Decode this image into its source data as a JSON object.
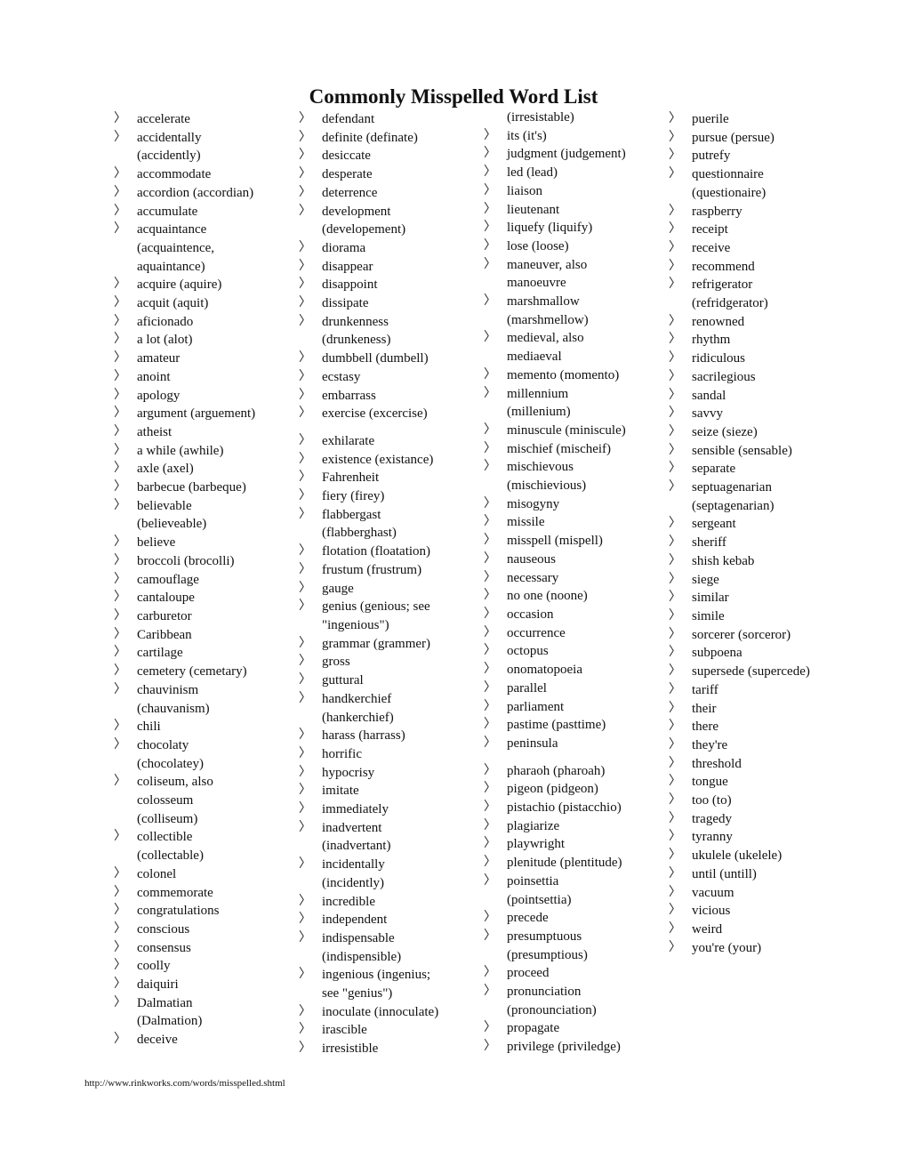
{
  "document": {
    "title": "Commonly Misspelled Word List",
    "bullet_glyph": "〉",
    "footer_url": "http://www.rinkworks.com/words/misspelled.shtml"
  },
  "columns": [
    {
      "entries": [
        {
          "lines": [
            "accelerate"
          ]
        },
        {
          "lines": [
            "accidentally",
            "(accidently)"
          ]
        },
        {
          "lines": [
            "accommodate"
          ]
        },
        {
          "lines": [
            "accordion (accordian)"
          ]
        },
        {
          "lines": [
            "accumulate"
          ]
        },
        {
          "lines": [
            "acquaintance",
            "(acquaintence,",
            "aquaintance)"
          ]
        },
        {
          "lines": [
            "acquire (aquire)"
          ]
        },
        {
          "lines": [
            "acquit (aquit)"
          ]
        },
        {
          "lines": [
            "aficionado"
          ]
        },
        {
          "lines": [
            "a lot (alot)"
          ]
        },
        {
          "lines": [
            "amateur"
          ]
        },
        {
          "lines": [
            "anoint"
          ]
        },
        {
          "lines": [
            "apology"
          ]
        },
        {
          "lines": [
            "argument (arguement)"
          ]
        },
        {
          "lines": [
            "atheist"
          ]
        },
        {
          "lines": [
            "a while (awhile)"
          ]
        },
        {
          "lines": [
            "axle (axel)"
          ]
        },
        {
          "lines": [
            "barbecue (barbeque)"
          ]
        },
        {
          "lines": [
            "believable",
            "(believeable)"
          ]
        },
        {
          "lines": [
            "believe"
          ]
        },
        {
          "lines": [
            "broccoli (brocolli)"
          ]
        },
        {
          "lines": [
            "camouflage"
          ]
        },
        {
          "lines": [
            "cantaloupe"
          ]
        },
        {
          "lines": [
            "carburetor"
          ]
        },
        {
          "lines": [
            "Caribbean"
          ]
        },
        {
          "lines": [
            "cartilage"
          ]
        },
        {
          "lines": [
            "cemetery (cemetary)"
          ]
        },
        {
          "lines": [
            "chauvinism",
            "(chauvanism)"
          ]
        },
        {
          "lines": [
            "chili"
          ]
        },
        {
          "lines": [
            "chocolaty",
            "(chocolatey)"
          ]
        },
        {
          "lines": [
            "coliseum, also",
            "colosseum",
            "(colliseum)"
          ]
        },
        {
          "lines": [
            "collectible",
            "(collectable)"
          ]
        },
        {
          "lines": [
            "colonel"
          ]
        },
        {
          "lines": [
            "commemorate"
          ]
        },
        {
          "lines": [
            "congratulations"
          ]
        },
        {
          "lines": [
            "conscious"
          ]
        },
        {
          "lines": [
            "consensus"
          ]
        },
        {
          "lines": [
            "coolly"
          ]
        },
        {
          "lines": [
            "daiquiri"
          ]
        },
        {
          "lines": [
            "Dalmatian",
            "(Dalmation)"
          ]
        },
        {
          "lines": [
            "deceive"
          ]
        }
      ]
    },
    {
      "entries": [
        {
          "lines": [
            "defendant"
          ]
        },
        {
          "lines": [
            "definite (definate)"
          ]
        },
        {
          "lines": [
            "desiccate"
          ]
        },
        {
          "lines": [
            "desperate"
          ]
        },
        {
          "lines": [
            "deterrence"
          ]
        },
        {
          "lines": [
            "development",
            "(developement)"
          ]
        },
        {
          "lines": [
            "diorama"
          ]
        },
        {
          "lines": [
            "disappear"
          ]
        },
        {
          "lines": [
            "disappoint"
          ]
        },
        {
          "lines": [
            "dissipate"
          ]
        },
        {
          "lines": [
            "drunkenness",
            "(drunkeness)"
          ]
        },
        {
          "lines": [
            "dumbbell (dumbell)"
          ]
        },
        {
          "lines": [
            "ecstasy"
          ]
        },
        {
          "lines": [
            "embarrass"
          ]
        },
        {
          "lines": [
            "exercise (excercise)"
          ],
          "gap_after": true
        },
        {
          "lines": [
            "exhilarate"
          ]
        },
        {
          "lines": [
            "existence (existance)"
          ]
        },
        {
          "lines": [
            "Fahrenheit"
          ]
        },
        {
          "lines": [
            "fiery (firey)"
          ]
        },
        {
          "lines": [
            "flabbergast",
            "(flabberghast)"
          ]
        },
        {
          "lines": [
            "flotation (floatation)"
          ]
        },
        {
          "lines": [
            "frustum (frustrum)"
          ]
        },
        {
          "lines": [
            "gauge"
          ]
        },
        {
          "lines": [
            "genius (genious; see",
            "\"ingenious\")"
          ]
        },
        {
          "lines": [
            "grammar (grammer)"
          ]
        },
        {
          "lines": [
            "gross"
          ]
        },
        {
          "lines": [
            "guttural"
          ]
        },
        {
          "lines": [
            "handkerchief",
            "(hankerchief)"
          ]
        },
        {
          "lines": [
            "harass (harrass)"
          ]
        },
        {
          "lines": [
            "horrific"
          ]
        },
        {
          "lines": [
            "hypocrisy"
          ]
        },
        {
          "lines": [
            "imitate"
          ]
        },
        {
          "lines": [
            "immediately"
          ]
        },
        {
          "lines": [
            "inadvertent",
            "(inadvertant)"
          ]
        },
        {
          "lines": [
            "incidentally",
            "(incidently)"
          ]
        },
        {
          "lines": [
            "incredible"
          ]
        },
        {
          "lines": [
            "independent"
          ]
        },
        {
          "lines": [
            "indispensable",
            "(indispensible)"
          ]
        },
        {
          "lines": [
            "ingenious (ingenius;",
            "see \"genius\")"
          ]
        },
        {
          "lines": [
            "inoculate (innoculate)"
          ]
        },
        {
          "lines": [
            "irascible"
          ]
        },
        {
          "lines": [
            "irresistible"
          ]
        }
      ]
    },
    {
      "continuation": "(irresistable)",
      "entries": [
        {
          "lines": [
            "its (it's)"
          ]
        },
        {
          "lines": [
            "judgment (judgement)"
          ]
        },
        {
          "lines": [
            "led (lead)"
          ]
        },
        {
          "lines": [
            "liaison"
          ]
        },
        {
          "lines": [
            "lieutenant"
          ]
        },
        {
          "lines": [
            "liquefy (liquify)"
          ]
        },
        {
          "lines": [
            "lose (loose)"
          ]
        },
        {
          "lines": [
            "maneuver, also",
            "manoeuvre"
          ]
        },
        {
          "lines": [
            "marshmallow",
            "(marshmellow)"
          ]
        },
        {
          "lines": [
            "medieval, also",
            "mediaeval"
          ]
        },
        {
          "lines": [
            "memento (momento)"
          ]
        },
        {
          "lines": [
            "millennium",
            "(millenium)"
          ]
        },
        {
          "lines": [
            "minuscule (miniscule)"
          ]
        },
        {
          "lines": [
            "mischief (mischeif)"
          ]
        },
        {
          "lines": [
            "mischievous",
            "(mischievious)"
          ]
        },
        {
          "lines": [
            "misogyny"
          ]
        },
        {
          "lines": [
            "missile"
          ]
        },
        {
          "lines": [
            "misspell (mispell)"
          ]
        },
        {
          "lines": [
            "nauseous"
          ]
        },
        {
          "lines": [
            "necessary"
          ]
        },
        {
          "lines": [
            "no one (noone)"
          ]
        },
        {
          "lines": [
            "occasion"
          ]
        },
        {
          "lines": [
            "occurrence"
          ]
        },
        {
          "lines": [
            "octopus"
          ]
        },
        {
          "lines": [
            "onomatopoeia"
          ]
        },
        {
          "lines": [
            "parallel"
          ]
        },
        {
          "lines": [
            "parliament"
          ]
        },
        {
          "lines": [
            "pastime (pasttime)"
          ]
        },
        {
          "lines": [
            "peninsula"
          ],
          "gap_after": true
        },
        {
          "lines": [
            "pharaoh (pharoah)"
          ]
        },
        {
          "lines": [
            "pigeon (pidgeon)"
          ]
        },
        {
          "lines": [
            "pistachio (pistacchio)"
          ]
        },
        {
          "lines": [
            "plagiarize"
          ]
        },
        {
          "lines": [
            "playwright"
          ]
        },
        {
          "lines": [
            "plenitude (plentitude)"
          ]
        },
        {
          "lines": [
            "poinsettia",
            "(pointsettia)"
          ]
        },
        {
          "lines": [
            "precede"
          ]
        },
        {
          "lines": [
            "presumptuous",
            "(presumptious)"
          ]
        },
        {
          "lines": [
            "proceed"
          ]
        },
        {
          "lines": [
            "pronunciation",
            "(pronounciation)"
          ]
        },
        {
          "lines": [
            "propagate"
          ]
        },
        {
          "lines": [
            "privilege (priviledge)"
          ]
        }
      ]
    },
    {
      "entries": [
        {
          "lines": [
            "puerile"
          ]
        },
        {
          "lines": [
            "pursue (persue)"
          ]
        },
        {
          "lines": [
            "putrefy"
          ]
        },
        {
          "lines": [
            "questionnaire",
            "(questionaire)"
          ]
        },
        {
          "lines": [
            "raspberry"
          ]
        },
        {
          "lines": [
            "receipt"
          ]
        },
        {
          "lines": [
            "receive"
          ]
        },
        {
          "lines": [
            "recommend"
          ]
        },
        {
          "lines": [
            "refrigerator",
            "(refridgerator)"
          ]
        },
        {
          "lines": [
            "renowned"
          ]
        },
        {
          "lines": [
            "rhythm"
          ]
        },
        {
          "lines": [
            "ridiculous"
          ]
        },
        {
          "lines": [
            "sacrilegious"
          ]
        },
        {
          "lines": [
            "sandal"
          ]
        },
        {
          "lines": [
            "savvy"
          ]
        },
        {
          "lines": [
            "seize (sieze)"
          ]
        },
        {
          "lines": [
            "sensible (sensable)"
          ]
        },
        {
          "lines": [
            "separate"
          ]
        },
        {
          "lines": [
            "septuagenarian",
            "(septagenarian)"
          ]
        },
        {
          "lines": [
            "sergeant"
          ]
        },
        {
          "lines": [
            "sheriff"
          ]
        },
        {
          "lines": [
            "shish kebab"
          ]
        },
        {
          "lines": [
            "siege"
          ]
        },
        {
          "lines": [
            "similar"
          ]
        },
        {
          "lines": [
            "simile"
          ]
        },
        {
          "lines": [
            "sorcerer (sorceror)"
          ]
        },
        {
          "lines": [
            "subpoena"
          ]
        },
        {
          "lines": [
            "supersede (supercede)"
          ]
        },
        {
          "lines": [
            "tariff"
          ]
        },
        {
          "lines": [
            "their"
          ]
        },
        {
          "lines": [
            "there"
          ]
        },
        {
          "lines": [
            "they're"
          ]
        },
        {
          "lines": [
            "threshold"
          ]
        },
        {
          "lines": [
            "tongue"
          ]
        },
        {
          "lines": [
            "too (to)"
          ]
        },
        {
          "lines": [
            "tragedy"
          ]
        },
        {
          "lines": [
            "tyranny"
          ]
        },
        {
          "lines": [
            "ukulele (ukelele)"
          ]
        },
        {
          "lines": [
            "until (untill)"
          ]
        },
        {
          "lines": [
            "vacuum"
          ]
        },
        {
          "lines": [
            "vicious"
          ]
        },
        {
          "lines": [
            "weird"
          ]
        },
        {
          "lines": [
            "you're (your)"
          ]
        }
      ]
    }
  ]
}
